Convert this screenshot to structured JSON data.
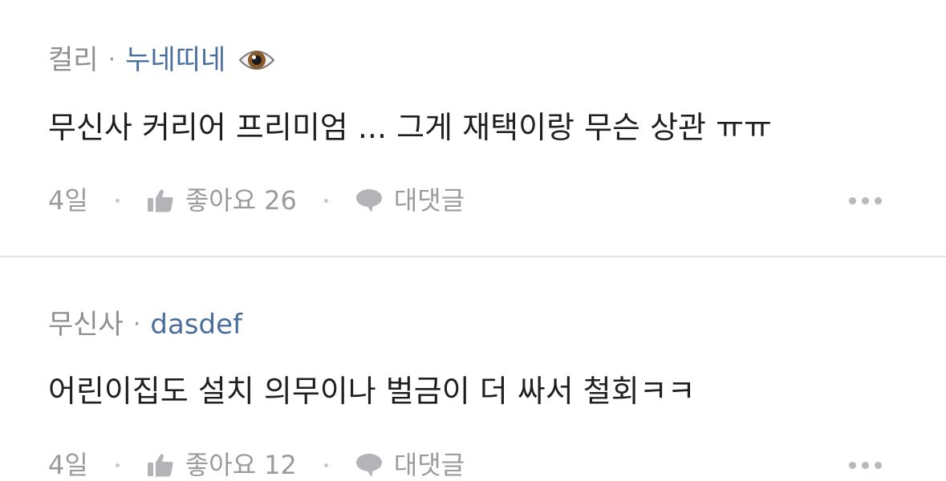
{
  "comments": [
    {
      "company": "컬리",
      "separator": "·",
      "nickname": "누네띠네",
      "emoji_icon": "eye-emoji-icon",
      "text": "무신사 커리어 프리미엄 ... 그게 재택이랑 무슨 상관 ㅠㅠ",
      "time": "4일",
      "like_label": "좋아요",
      "like_count": "26",
      "reply_label": "대댓글"
    },
    {
      "company": "무신사",
      "separator": "·",
      "nickname": "dasdef",
      "text": "어린이집도 설치 의무이나 벌금이 더 싸서 철회ㅋㅋ",
      "time": "4일",
      "like_label": "좋아요",
      "like_count": "12",
      "reply_label": "대댓글"
    }
  ],
  "colors": {
    "nickname": "#4a6f9e",
    "muted": "#9a9a9f",
    "text": "#1f1f1f",
    "divider": "#e2e2e5"
  }
}
